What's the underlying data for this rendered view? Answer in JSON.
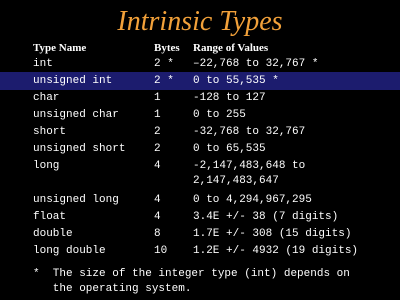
{
  "title": "Intrinsic Types",
  "headers": {
    "type": "Type Name",
    "bytes": "Bytes",
    "range": "Range of Values"
  },
  "rows": [
    {
      "type": "int",
      "bytes": "2 *",
      "range": "–22,768 to 32,767 *"
    },
    {
      "type": "unsigned int",
      "bytes": "2 *",
      "range": "0 to 55,535 *"
    },
    {
      "type": "char",
      "bytes": "1",
      "range": "-128 to 127"
    },
    {
      "type": "unsigned char",
      "bytes": "1",
      "range": "0 to 255"
    },
    {
      "type": "short",
      "bytes": "2",
      "range": "-32,768 to 32,767"
    },
    {
      "type": "unsigned short",
      "bytes": "2",
      "range": "0 to 65,535"
    },
    {
      "type": "long",
      "bytes": "4",
      "range": "-2,147,483,648 to\n2,147,483,647"
    },
    {
      "type": "unsigned long",
      "bytes": "4",
      "range": "0 to 4,294,967,295"
    },
    {
      "type": "float",
      "bytes": "4",
      "range": "3.4E +/- 38 (7 digits)"
    },
    {
      "type": "double",
      "bytes": "8",
      "range": "1.7E +/- 308 (15 digits)"
    },
    {
      "type": "long double",
      "bytes": "10",
      "range": "1.2E +/- 4932 (19 digits)"
    }
  ],
  "footnote": "*  The size of the integer type (int) depends on\n   the operating system.",
  "colors": {
    "background": "#000000",
    "title": "#f2a13a",
    "text": "#ffffff",
    "highlight_row": "#1c1c6e"
  }
}
